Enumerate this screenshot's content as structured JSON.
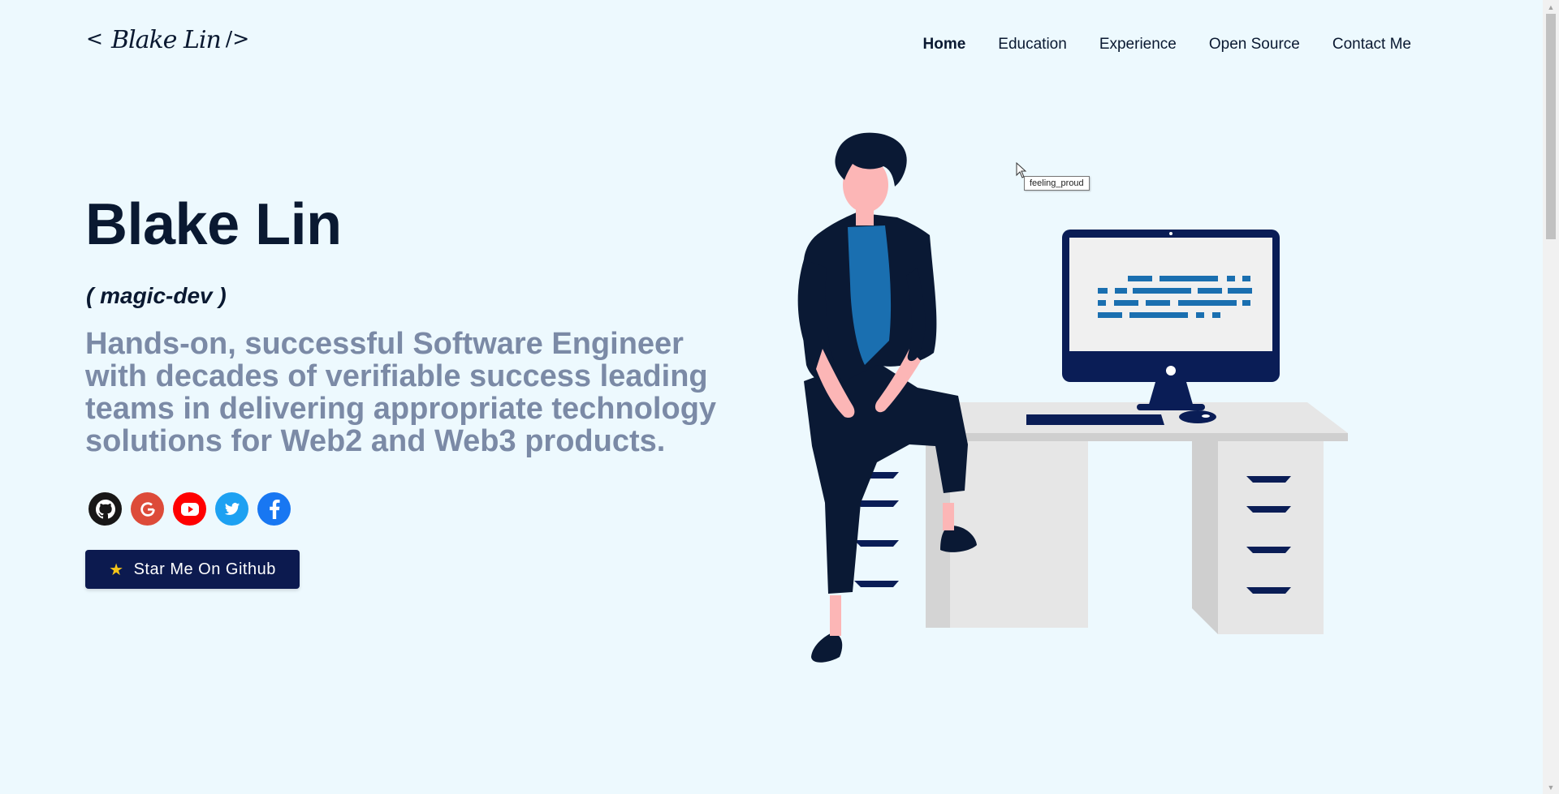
{
  "header": {
    "logo_open": "<",
    "logo_signature": "Blake Lin",
    "logo_close": "/>",
    "nav": [
      {
        "label": "Home"
      },
      {
        "label": "Education"
      },
      {
        "label": "Experience"
      },
      {
        "label": "Open Source"
      },
      {
        "label": "Contact Me"
      }
    ]
  },
  "hero": {
    "name": "Blake Lin",
    "subtitle": "( magic-dev )",
    "description": "Hands-on, successful Software Engineer with decades of verifiable success leading teams in delivering appropriate technology solutions for Web2 and Web3 products.",
    "social_icons": [
      {
        "icon": "github-icon",
        "color": "#181717"
      },
      {
        "icon": "google-icon",
        "color": "#dd4b39"
      },
      {
        "icon": "youtube-icon",
        "color": "#ff0000"
      },
      {
        "icon": "twitter-icon",
        "color": "#1da1f2"
      },
      {
        "icon": "facebook-icon",
        "color": "#1877f2"
      }
    ],
    "cta_label": "Star Me On Github"
  },
  "illustration": {
    "tooltip": "feeling_proud"
  },
  "colors": {
    "background": "#edf9fe",
    "primary": "#0a1931",
    "muted_text": "#7b8aa6",
    "button": "#0c1a4f"
  }
}
